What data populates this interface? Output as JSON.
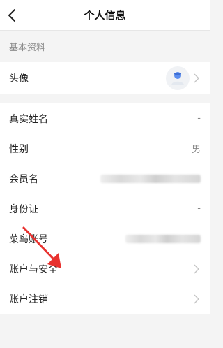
{
  "header": {
    "title": "个人信息"
  },
  "section_basic": {
    "title": "基本资料"
  },
  "avatar_row": {
    "label": "头像"
  },
  "rows": {
    "real_name": {
      "label": "真实姓名",
      "value": "-"
    },
    "gender": {
      "label": "性别",
      "value": "男"
    },
    "member_name": {
      "label": "会员名"
    },
    "id_card": {
      "label": "身份证",
      "value": "-"
    },
    "cainiao": {
      "label": "菜鸟账号"
    },
    "account_security": {
      "label": "账户与安全"
    },
    "account_cancel": {
      "label": "账户注销"
    }
  },
  "colors": {
    "arrow": "#e8322f",
    "avatar_accent": "#5b8def"
  },
  "icons": [
    "back-arrow-icon",
    "chevron-right-icon",
    "avatar-placeholder-icon"
  ]
}
